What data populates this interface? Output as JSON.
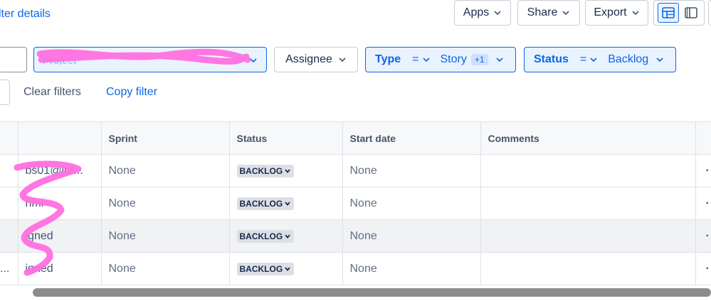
{
  "header": {
    "filter_details_link": "lter details",
    "apps_label": "Apps",
    "share_label": "Share",
    "export_label": "Export"
  },
  "filters": {
    "project": {
      "key": "Project",
      "value": ""
    },
    "assignee": {
      "label": "Assignee"
    },
    "type": {
      "key": "Type",
      "op": "=",
      "value": "Story",
      "extra": "+1"
    },
    "status": {
      "key": "Status",
      "op": "=",
      "value": "Backlog"
    }
  },
  "actions": {
    "clear_filters": "Clear filters",
    "copy_filter": "Copy filter"
  },
  "table": {
    "columns": [
      "",
      "Sprint",
      "Status",
      "Start date",
      "Comments"
    ],
    "rows": [
      {
        "assignee": "bs01@inf...",
        "sprint": "None",
        "status": "BACKLOG",
        "start_date": "None",
        "comments": "",
        "more": "·"
      },
      {
        "assignee": "nmi",
        "sprint": "None",
        "status": "BACKLOG",
        "start_date": "None",
        "comments": "",
        "more": "·"
      },
      {
        "assignee": "igned",
        "sprint": "None",
        "status": "BACKLOG",
        "start_date": "None",
        "comments": "",
        "more": "·"
      },
      {
        "assignee": "igned",
        "sprint": "None",
        "status": "BACKLOG",
        "start_date": "None",
        "comments": "",
        "more": "·"
      }
    ],
    "row_prefix": "..."
  },
  "colors": {
    "accent": "#0c66e4",
    "selected_bg": "#e9f2ff",
    "redaction": "#ff6fe0"
  }
}
